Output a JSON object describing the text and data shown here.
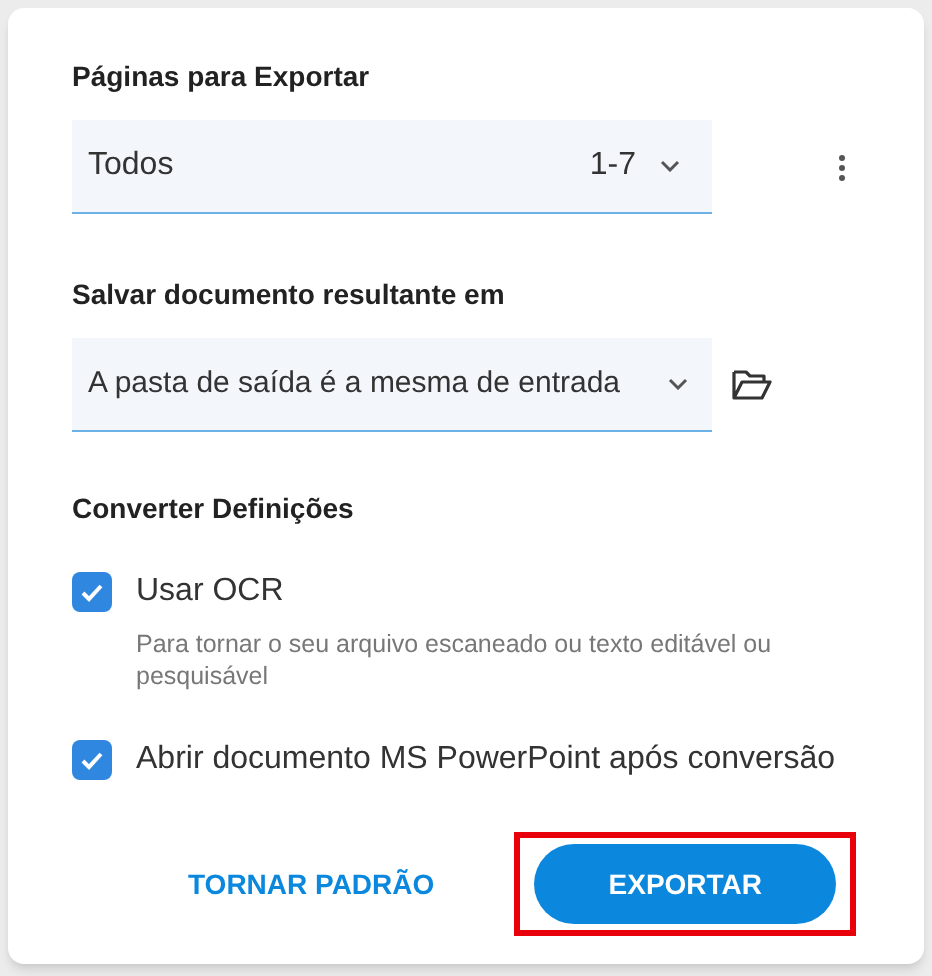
{
  "pages": {
    "label": "Páginas para Exportar",
    "value": "Todos",
    "range": "1-7"
  },
  "output": {
    "label": "Salvar documento resultante em",
    "value": "A pasta de saída é a mesma de entrada"
  },
  "settings": {
    "title": "Converter Definições",
    "options": [
      {
        "label": "Usar OCR",
        "checked": true,
        "description": "Para tornar o seu arquivo escaneado ou texto editável ou pesquisável"
      },
      {
        "label": "Abrir documento MS PowerPoint após conversão",
        "checked": true
      }
    ]
  },
  "buttons": [
    {
      "label": "TORNAR PADRÃO",
      "kind": "text",
      "highlighted": false
    },
    {
      "label": "EXPORTAR",
      "kind": "primary",
      "highlighted": true
    }
  ]
}
